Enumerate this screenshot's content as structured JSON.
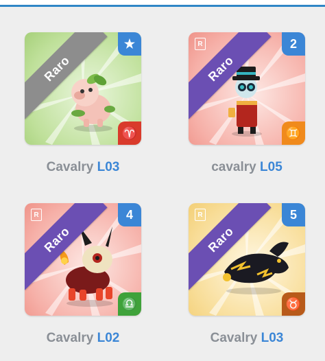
{
  "cards": [
    {
      "rarity": "Raro",
      "name": "Cavalry",
      "level": "L03",
      "top_badge": "★",
      "top_badge_icon": "star-icon",
      "sign_icon": "aries-icon",
      "sign_glyph": "♈",
      "colors": {
        "bg1": "#d8ecc4",
        "bg2": "#a9d47c",
        "sign": "#d93a2b",
        "ribbon": "#8d8d8d"
      }
    },
    {
      "rarity": "Raro",
      "name": "cavalry",
      "level": "L05",
      "top_badge": "2",
      "top_badge_icon": "number-badge",
      "sign_icon": "gemini-icon",
      "sign_glyph": "♊",
      "colors": {
        "bg1": "#fde0dc",
        "bg2": "#f4a39a",
        "sign": "#f08a1c",
        "ribbon": "#6b4fb3"
      }
    },
    {
      "rarity": "Raro",
      "name": "Cavalry",
      "level": "L02",
      "top_badge": "4",
      "top_badge_icon": "number-badge",
      "sign_icon": "libra-icon",
      "sign_glyph": "♎",
      "colors": {
        "bg1": "#fde0dc",
        "bg2": "#f4a39a",
        "sign": "#3fa23a",
        "ribbon": "#6b4fb3"
      }
    },
    {
      "rarity": "Raro",
      "name": "Cavalry",
      "level": "L03",
      "top_badge": "5",
      "top_badge_icon": "number-badge",
      "sign_icon": "taurus-icon",
      "sign_glyph": "♉",
      "colors": {
        "bg1": "#fdf2d2",
        "bg2": "#f7d98a",
        "sign": "#b85a1a",
        "ribbon": "#6b4fb3"
      }
    }
  ],
  "rare_icon_letter": "R",
  "accent": "#3b86d6"
}
